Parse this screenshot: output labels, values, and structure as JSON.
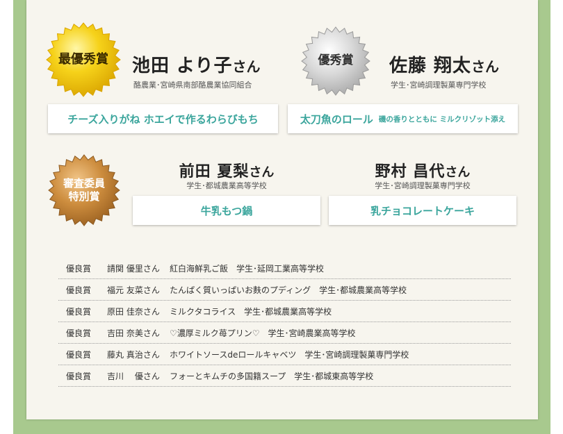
{
  "awards": {
    "grand_prize": {
      "badge_label": "最優秀賞",
      "name": "池田 より子",
      "honorific": "さん",
      "affiliation": "酪農業･宮崎県南部酪農業協同組合",
      "dish": "チーズ入りがね ホエイで作るわらびもち",
      "dish_sub": ""
    },
    "excellence": {
      "badge_label": "優秀賞",
      "name": "佐藤 翔太",
      "honorific": "さん",
      "affiliation": "学生･宮崎調理製菓専門学校",
      "dish": "太刀魚のロール",
      "dish_sub": "磯の香りとともに ミルクリゾット添え"
    },
    "jury_special": {
      "badge_line1": "審査委員",
      "badge_line2": "特別賞",
      "winners": [
        {
          "name": "前田 夏梨",
          "honorific": "さん",
          "affiliation": "学生･都城農業高等学校",
          "dish": "牛乳もつ鍋"
        },
        {
          "name": "野村 昌代",
          "honorific": "さん",
          "affiliation": "学生･宮崎調理製菓専門学校",
          "dish": "乳チョコレートケーキ"
        }
      ]
    },
    "merit_list": [
      {
        "award": "優良賞",
        "person": "請関 優里さん",
        "detail": "紅白海鮮乳ご飯　学生･延岡工業高等学校"
      },
      {
        "award": "優良賞",
        "person": "福元 友菜さん",
        "detail": "たんぱく質いっぱいお麩のプディング　学生･都城農業高等学校"
      },
      {
        "award": "優良賞",
        "person": "原田 佳奈さん",
        "detail": "ミルクタコライス　学生･都城農業高等学校"
      },
      {
        "award": "優良賞",
        "person": "吉田 奈美さん",
        "detail": "♡濃厚ミルク苺プリン♡　学生･宮崎農業高等学校"
      },
      {
        "award": "優良賞",
        "person": "藤丸 真治さん",
        "detail": "ホワイトソースdeロールキャベツ　学生･宮崎調理製菓専門学校"
      },
      {
        "award": "優良賞",
        "person": "吉川　 優さん",
        "detail": "フォーとキムチの多国籍スープ　学生･都城東高等学校"
      }
    ]
  },
  "colors": {
    "frame_green": "#a8c98e",
    "panel_bg": "#f7f5ee",
    "dish_teal": "#3aa59c",
    "gold": "#f2c200",
    "silver": "#c8c8c8",
    "bronze": "#c88a3c"
  },
  "icons": [
    "gold-seal-icon",
    "silver-seal-icon",
    "bronze-seal-icon"
  ]
}
